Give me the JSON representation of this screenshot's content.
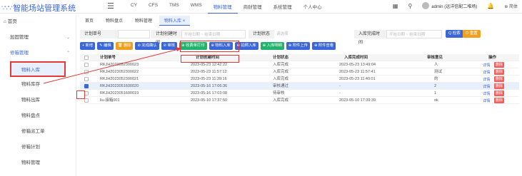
{
  "header": {
    "logo_mark": "∵∵∵",
    "title": "智能场站管理系统",
    "menu_icon": "menu-icon",
    "nav": [
      "CY",
      "CFS",
      "TMS",
      "WMS",
      "物料管理",
      "商财管理",
      "系统管理",
      "个人中心"
    ],
    "user": "admin (远洋信配二堆场)",
    "lang": "简体"
  },
  "sidebar": {
    "home": "首页",
    "group1": "加固管理",
    "group2": "修箱管理",
    "items": [
      "物料入库",
      "物料库存",
      "物料出库",
      "物料盘点",
      "修箱派工单",
      "修箱计划",
      "物料管理"
    ]
  },
  "tabs": [
    "首页",
    "物料盘点",
    "物料管理",
    "物料入库 ×"
  ],
  "filter": {
    "label1": "计划单号",
    "label2": "计划创建时间",
    "date_start_placeholder": "开始日期",
    "date_sep": "~",
    "date_end_placeholder": "结束日期",
    "label3": "计划状态",
    "status_placeholder": "请选择",
    "label4": "入库完成时间",
    "date2_start_placeholder": "开始日期",
    "date2_end_placeholder": "结束日期",
    "search": "Q 检索",
    "reset": "O 重置"
  },
  "toolbar": [
    {
      "label": "+ 新增",
      "color": "#3a66d8"
    },
    {
      "label": "✎ 编辑",
      "color": "#3a66d8"
    },
    {
      "label": "🗑 删除",
      "color": "#f0a020"
    },
    {
      "label": "⊘ 完成确认",
      "color": "#3a66d8"
    },
    {
      "label": "⊘ 审核",
      "color": "#3a66d8"
    },
    {
      "label": "⊕ 收费单打印",
      "color": "#21b36b"
    },
    {
      "label": "⊕ 物料入库",
      "color": "#3a66d8"
    },
    {
      "label": "⊕ 拍照入库",
      "color": "#3a66d8"
    },
    {
      "label": "⊕ 入库明细",
      "color": "#21b36b"
    },
    {
      "label": "⊕ 附件上传",
      "color": "#3a66d8"
    },
    {
      "label": "⊕ 附件查看",
      "color": "#3a66d8"
    }
  ],
  "table": {
    "headers": [
      "计划单号",
      "计划创建时间",
      "计划状态",
      "入库完成时间",
      "审核意见",
      "操作"
    ],
    "rows": [
      {
        "no": "RKJH2023052300023",
        "created": "2023-05-23 12:42:22",
        "status": "入库完成",
        "done": "2023-05-23 13:49:04",
        "remark": "人",
        "selected": false
      },
      {
        "no": "RKJH2023052300022",
        "created": "2023-05-23 11:57:12",
        "status": "入库完成",
        "done": "2023-05-23 11:57:41",
        "remark": "测试",
        "selected": false
      },
      {
        "no": "RKJH2023052300021",
        "created": "2023-05-23 11:39:16",
        "status": "入库完成",
        "done": "2023-05-23 11:40:01",
        "remark": "的",
        "selected": false
      },
      {
        "no": "RKJH2023051600020",
        "created": "2023-05-16 17:06:36",
        "status": "审核通过",
        "done": "-",
        "remark": "2",
        "selected": true
      },
      {
        "no": "RKJH2023051600019",
        "created": "2023-05-16 17:03:08",
        "status": "待审核",
        "done": "-",
        "remark": "1",
        "selected": false
      },
      {
        "no": "liu-接箱001",
        "created": "2023-05-10 17:37:50",
        "status": "入库完成",
        "done": "2023-05-10 17:39:39",
        "remark": "ok",
        "selected": false
      }
    ],
    "op_detail": "详情",
    "op_delete": "删除"
  },
  "colors": {
    "accent": "#3a66d8",
    "danger": "#f25f5c",
    "highlight": "#e53935"
  }
}
